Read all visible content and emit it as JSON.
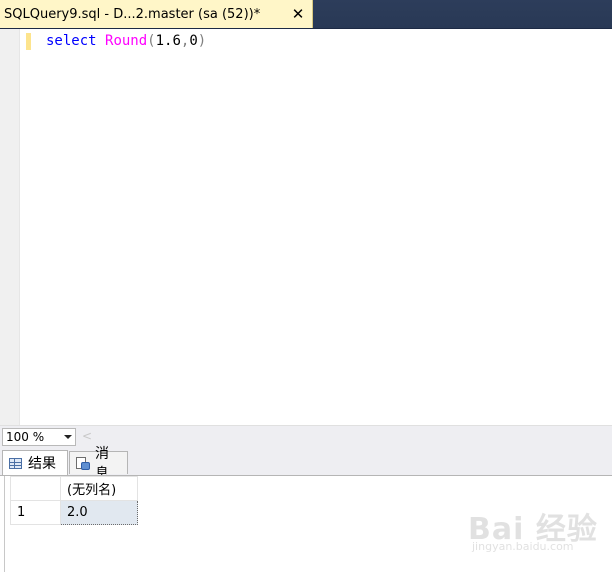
{
  "document_tab": {
    "title": "SQLQuery9.sql - D...2.master (sa (52))*",
    "close_glyph": "✕"
  },
  "editor": {
    "code": {
      "keyword": "select",
      "function": "Round",
      "open_paren": "(",
      "arg1": "1.6",
      "comma": ",",
      "arg2": "0",
      "close_paren": ")"
    }
  },
  "zoom": {
    "value": "100 %",
    "scroll_left_glyph": "<"
  },
  "result_tabs": {
    "results_label": "结果",
    "messages_label": "消息"
  },
  "results_grid": {
    "column_header": "(无列名)",
    "rows": [
      {
        "row_number": "1",
        "value": "2.0"
      }
    ]
  },
  "watermark": {
    "main": "Bai 经验",
    "sub": "jingyan.baidu.com"
  },
  "colors": {
    "tab_active_bg": "#fff6c8",
    "tab_strip_bg": "#2b3a55",
    "keyword": "#0000ff",
    "function": "#ff00ff",
    "punctuation": "#808080",
    "change_bar": "#fde48d"
  }
}
